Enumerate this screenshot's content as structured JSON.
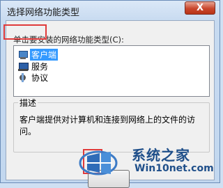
{
  "window": {
    "title": "选择网络功能类型",
    "close_label": "X"
  },
  "prompt": "单击要安装的网络功能类型(C):",
  "list": {
    "items": [
      {
        "label": "客户端",
        "icon": "client-icon",
        "selected": true
      },
      {
        "label": "服务",
        "icon": "service-icon",
        "selected": false
      },
      {
        "label": "协议",
        "icon": "protocol-icon",
        "selected": false
      }
    ]
  },
  "description": {
    "title": "描述",
    "text": "客户端提供对计算机和连接到网络上的文件的访问。"
  },
  "watermark": {
    "title": "系统之家",
    "url": "Win10net.com"
  },
  "colors": {
    "selection": "#3399ff",
    "annotation": "#e03a3a",
    "close": "#c9462c"
  }
}
